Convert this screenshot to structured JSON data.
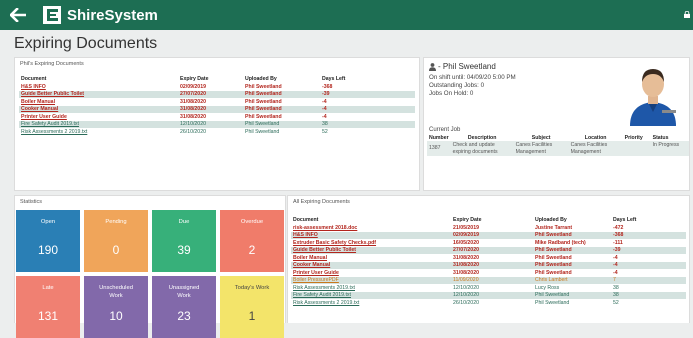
{
  "app": {
    "name": "ShireSystem"
  },
  "page": {
    "title": "Expiring Documents"
  },
  "phil_docs": {
    "title": "Phil's Expiring Documents",
    "headers": [
      "Document",
      "Expiry Date",
      "Uploaded By",
      "Days Left"
    ],
    "rows": [
      {
        "doc": "H&S INFO",
        "date": "02/09/2019",
        "by": "Phil Sweetland",
        "days": "-368",
        "style": "red"
      },
      {
        "doc": "Guide Better Public Toilet",
        "date": "27/07/2020",
        "by": "Phil Sweetland",
        "days": "-39",
        "style": "red"
      },
      {
        "doc": "Boiler Manual",
        "date": "31/08/2020",
        "by": "Phil Sweetland",
        "days": "-4",
        "style": "red"
      },
      {
        "doc": "Cooker Manual",
        "date": "31/08/2020",
        "by": "Phil Sweetland",
        "days": "-4",
        "style": "red"
      },
      {
        "doc": "Printer User Guide",
        "date": "31/08/2020",
        "by": "Phil Sweetland",
        "days": "-4",
        "style": "red"
      },
      {
        "doc": "Fire Safety Audit 2019.txt",
        "date": "12/10/2020",
        "by": "Phil Sweetland",
        "days": "38",
        "style": "norm"
      },
      {
        "doc": "Risk Assessments 2 2019.txt",
        "date": "26/10/2020",
        "by": "Phil Sweetland",
        "days": "52",
        "style": "norm"
      }
    ]
  },
  "profile": {
    "name": "- Phil Sweetland",
    "shift": "On shift until: 04/09/20 5:00 PM",
    "outstanding": "Outstanding Jobs: 0",
    "on_hold": "Jobs On Hold: 0",
    "current_job_title": "Current Job",
    "job_headers": [
      "Number",
      "Description",
      "Subject",
      "Location",
      "Priority",
      "Status"
    ],
    "job": {
      "number": "1387",
      "description": "Check and update expiring documents",
      "subject": "Canes Facilities Management",
      "location": "Canes Facilities Management",
      "priority": "",
      "status": "In Progress"
    }
  },
  "statistics": {
    "title": "Statistics",
    "tiles": [
      {
        "label": "Open",
        "value": "190",
        "color": "#2a7fb5"
      },
      {
        "label": "Pending",
        "value": "0",
        "color": "#f0a55a"
      },
      {
        "label": "Due",
        "value": "39",
        "color": "#37b07a"
      },
      {
        "label": "Overdue",
        "value": "2",
        "color": "#f07c6a"
      },
      {
        "label": "Late",
        "value": "131",
        "color": "#f08072"
      },
      {
        "label": "Unscheduled Work",
        "value": "10",
        "color": "#8269aa"
      },
      {
        "label": "Unassigned Work",
        "value": "23",
        "color": "#8269aa"
      },
      {
        "label": "Today's Work",
        "value": "1",
        "color": "#f3e46a",
        "text_color": "#444"
      }
    ]
  },
  "all_docs": {
    "title": "All Expiring Documents",
    "headers": [
      "Document",
      "Expiry Date",
      "Uploaded By",
      "Days Left"
    ],
    "rows": [
      {
        "doc": "risk-assessment 2018.doc",
        "date": "21/05/2019",
        "by": "Justine Tarrant",
        "days": "-472",
        "style": "red"
      },
      {
        "doc": "H&S INFO",
        "date": "02/09/2019",
        "by": "Phil Sweetland",
        "days": "-368",
        "style": "red"
      },
      {
        "doc": "Extruder Basic Safety Checks.pdf",
        "date": "16/05/2020",
        "by": "Mike Radband (tech)",
        "days": "-111",
        "style": "red"
      },
      {
        "doc": "Guide Better Public Toilet",
        "date": "27/07/2020",
        "by": "Phil Sweetland",
        "days": "-39",
        "style": "red"
      },
      {
        "doc": "Boiler Manual",
        "date": "31/08/2020",
        "by": "Phil Sweetland",
        "days": "-4",
        "style": "red"
      },
      {
        "doc": "Cooker Manual",
        "date": "31/08/2020",
        "by": "Phil Sweetland",
        "days": "-4",
        "style": "red"
      },
      {
        "doc": "Printer User Guide",
        "date": "31/08/2020",
        "by": "Phil Sweetland",
        "days": "-4",
        "style": "red"
      },
      {
        "doc": "Boiler PressurePDF",
        "date": "11/09/2020",
        "by": "Chris Lambert",
        "days": "7",
        "style": "amber"
      },
      {
        "doc": "Risk Assessments 2019.txt",
        "date": "12/10/2020",
        "by": "Lucy Ross",
        "days": "38",
        "style": "norm"
      },
      {
        "doc": "Fire Safety Audit 2019.txt",
        "date": "12/10/2020",
        "by": "Phil Sweetland",
        "days": "38",
        "style": "norm"
      },
      {
        "doc": "Risk Assessments 2 2019.txt",
        "date": "26/10/2020",
        "by": "Phil Sweetland",
        "days": "52",
        "style": "norm"
      }
    ]
  }
}
